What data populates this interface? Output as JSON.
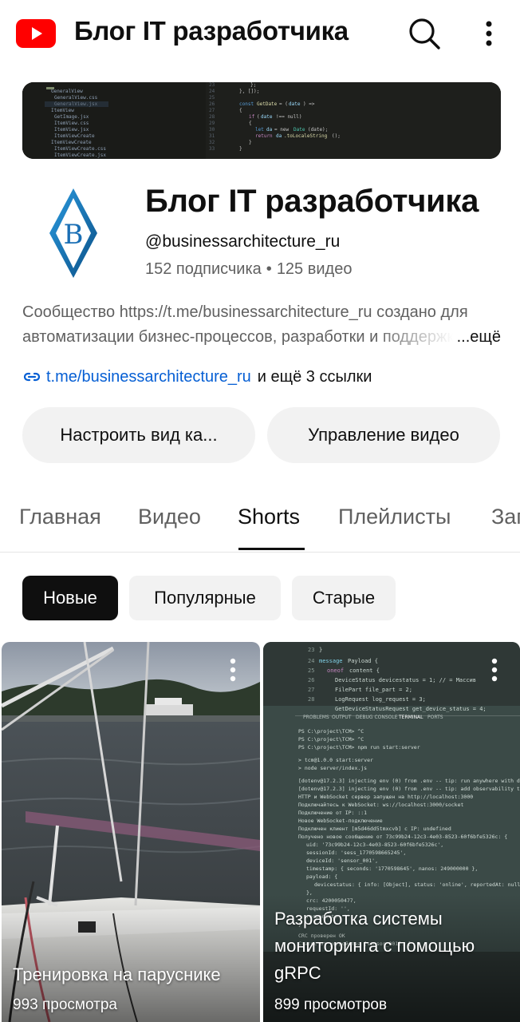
{
  "topbar": {
    "title": "Блог IT разработчика",
    "logo_icon": "youtube-logo-icon",
    "search_icon": "search-icon",
    "more_icon": "more-vertical-icon"
  },
  "channel": {
    "name": "Блог IT разработчика",
    "handle": "@businessarchitecture_ru",
    "subscribers": "152 подписчика",
    "videos": "125 видео",
    "dot": "•",
    "description_line1": "Сообщество https://t.me/businessarchitecture_ru создано для",
    "description_line2": "автоматизации бизнес-процессов, разработки и поддержки",
    "description_more": "...ещё",
    "link_text": "t.me/businessarchitecture_ru",
    "link_extra": "и ещё 3 ссылки",
    "avatar_letter": "B"
  },
  "buttons": {
    "customize": "Настроить вид ка...",
    "manage": "Управление видео"
  },
  "tabs": [
    {
      "label": "Главная"
    },
    {
      "label": "Видео"
    },
    {
      "label": "Shorts"
    },
    {
      "label": "Плейлисты"
    },
    {
      "label": "Записи"
    }
  ],
  "chips": {
    "new": "Новые",
    "popular": "Популярные",
    "old": "Старые"
  },
  "shorts": [
    {
      "title": "Тренировка на паруснике",
      "views": "993 просмотра"
    },
    {
      "title_line1": "Разработка системы",
      "title_line2": "мониторинга с помощью",
      "title_line3": "gRPC",
      "views": "899 просмотров"
    }
  ],
  "colors": {
    "brand_red": "#ff0000",
    "link_blue": "#065fd4",
    "text": "#0f0f0f",
    "secondary": "#606060",
    "chip_bg": "#f2f2f2"
  }
}
